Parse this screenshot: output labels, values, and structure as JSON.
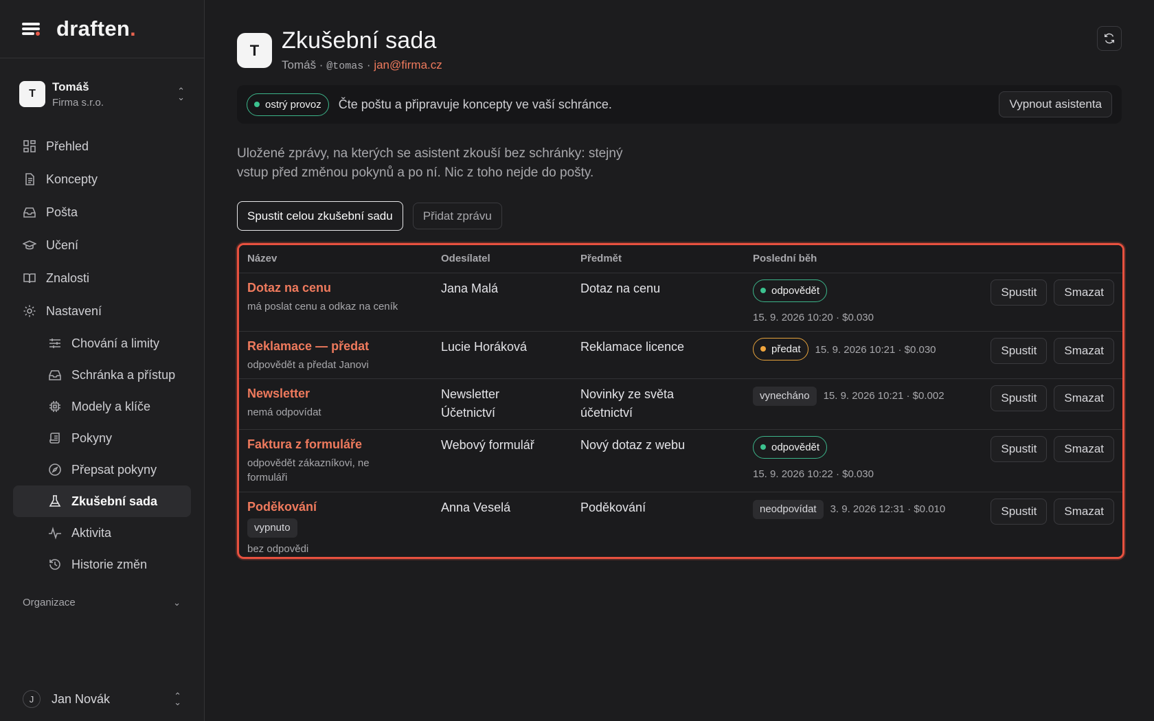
{
  "brand": {
    "name": "draften",
    "dot": "."
  },
  "account": {
    "initial": "T",
    "name": "Tomáš",
    "org": "Firma s.r.o."
  },
  "nav": {
    "items": [
      {
        "label": "Přehled",
        "icon": "grid-icon"
      },
      {
        "label": "Koncepty",
        "icon": "document-icon"
      },
      {
        "label": "Pošta",
        "icon": "inbox-icon"
      },
      {
        "label": "Učení",
        "icon": "graduation-cap-icon"
      },
      {
        "label": "Znalosti",
        "icon": "book-icon"
      },
      {
        "label": "Nastavení",
        "icon": "gear-icon"
      }
    ],
    "sub_items": [
      {
        "label": "Chování a limity",
        "icon": "sliders-icon"
      },
      {
        "label": "Schránka a přístup",
        "icon": "inbox-icon"
      },
      {
        "label": "Modely a klíče",
        "icon": "chip-icon"
      },
      {
        "label": "Pokyny",
        "icon": "scroll-icon"
      },
      {
        "label": "Přepsat pokyny",
        "icon": "compass-icon"
      },
      {
        "label": "Zkušební sada",
        "icon": "flask-icon",
        "active": true
      },
      {
        "label": "Aktivita",
        "icon": "activity-icon"
      },
      {
        "label": "Historie změn",
        "icon": "history-icon"
      }
    ],
    "org_section": "Organizace"
  },
  "user": {
    "initial": "J",
    "name": "Jan Novák"
  },
  "header": {
    "initial": "T",
    "title": "Zkušební sada",
    "owner": "Tomáš",
    "sep": " · ",
    "handle": "@tomas",
    "email": "jan@firma.cz"
  },
  "banner": {
    "status": "ostrý provoz",
    "text": "Čte poštu a připravuje koncepty ve vaší schránce.",
    "button": "Vypnout asistenta"
  },
  "description": "Uložené zprávy, na kterých se asistent zkouší bez schránky: stejný vstup před změnou pokynů a po ní. Nic z toho nejde do pošty.",
  "actions": {
    "run_all": "Spustit celou zkušební sadu",
    "add": "Přidat zprávu"
  },
  "table": {
    "headers": [
      "Název",
      "Odesílatel",
      "Předmět",
      "Poslední běh"
    ],
    "run_label": "Spustit",
    "delete_label": "Smazat",
    "rows": [
      {
        "name": "Dotaz na cenu",
        "note": "má poslat cenu a odkaz na ceník",
        "sender": "Jana Malá",
        "subject": "Dotaz na cenu",
        "result": "odpovědět",
        "result_style": "green",
        "meta": "15. 9. 2026 10:20 · $0.030"
      },
      {
        "name": "Reklamace — předat",
        "note": "odpovědět a předat Janovi",
        "sender": "Lucie Horáková",
        "subject": "Reklamace licence",
        "result": "předat",
        "result_style": "orange",
        "meta": "15. 9. 2026 10:21 · $0.030"
      },
      {
        "name": "Newsletter",
        "note": "nemá odpovídat",
        "sender": "Newsletter Účetnictví",
        "subject": "Novinky ze světa účetnictví",
        "result": "vynecháno",
        "result_style": "tag",
        "meta": "15. 9. 2026 10:21 · $0.002"
      },
      {
        "name": "Faktura z formuláře",
        "note": "odpovědět zákazníkovi, ne formuláři",
        "sender": "Webový formulář",
        "subject": "Nový dotaz z webu",
        "result": "odpovědět",
        "result_style": "green",
        "meta": "15. 9. 2026 10:22 · $0.030"
      },
      {
        "name": "Poděkování",
        "badge": "vypnuto",
        "note": "bez odpovědi",
        "sender": "Anna Veselá",
        "subject": "Poděkování",
        "result": "neodpovídat",
        "result_style": "tag",
        "meta": "3. 9. 2026 12:31 · $0.010"
      }
    ]
  },
  "colors": {
    "accent": "#ef7a5d",
    "highlight": "#e8513f",
    "ok": "#3cc28f",
    "warn": "#f0a53d"
  }
}
